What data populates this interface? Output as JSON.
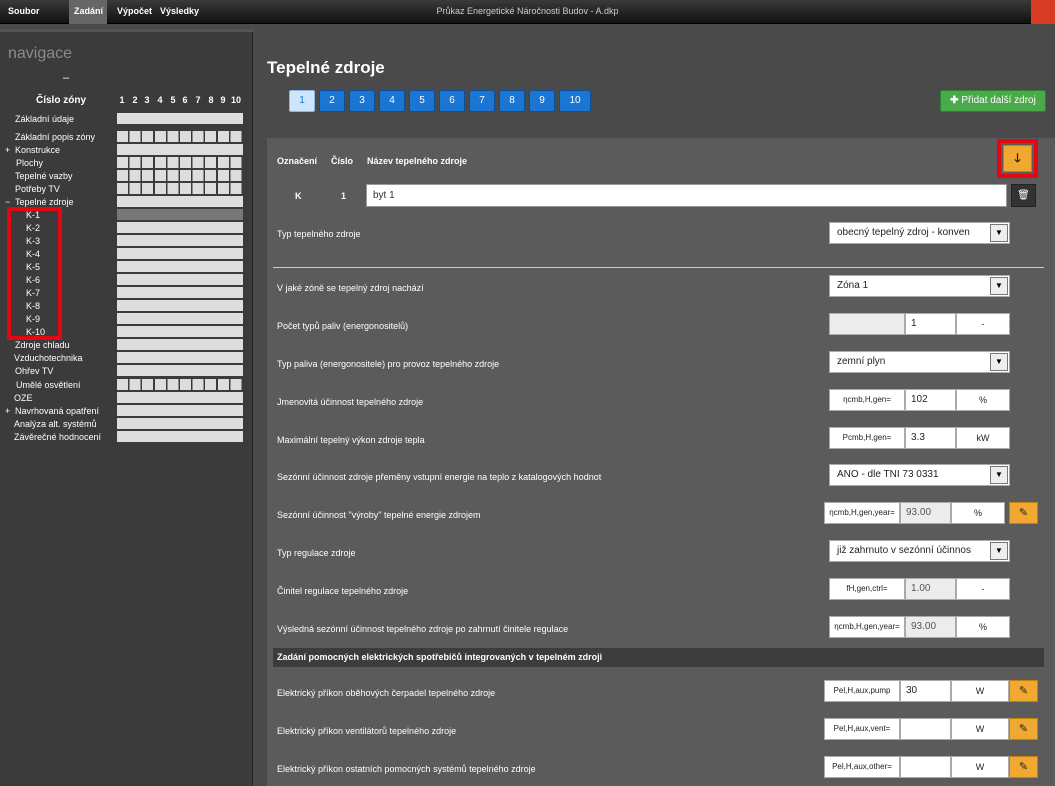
{
  "menu": {
    "soubor": "Soubor",
    "zadani": "Zadání",
    "vypocet": "Výpočet",
    "vysledky": "Výsledky"
  },
  "app_title": "Průkaz Energetické Náročnosti Budov - A.dkp",
  "sidebar": {
    "title": "navigace",
    "dash": "–",
    "zone_caption": "Číslo zóny",
    "zone_numbers": [
      "1",
      "2",
      "3",
      "4",
      "5",
      "6",
      "7",
      "8",
      "9",
      "10"
    ],
    "items": [
      {
        "label": "Základní údaje"
      },
      {
        "label": "Základní popis zóny"
      },
      {
        "label": "Konstrukce",
        "prefix": "+"
      },
      {
        "label": "Plochy"
      },
      {
        "label": "Tepelné vazby"
      },
      {
        "label": "Potřeby TV"
      },
      {
        "label": "Tepelné zdroje",
        "prefix": "−"
      },
      {
        "label": "K-1"
      },
      {
        "label": "K-2"
      },
      {
        "label": "K-3"
      },
      {
        "label": "K-4"
      },
      {
        "label": "K-5"
      },
      {
        "label": "K-6"
      },
      {
        "label": "K-7"
      },
      {
        "label": "K-8"
      },
      {
        "label": "K-9"
      },
      {
        "label": "K-10"
      },
      {
        "label": "Zdroje chladu"
      },
      {
        "label": "Vzduchotechnika"
      },
      {
        "label": "Ohřev TV"
      },
      {
        "label": "Umělé osvětlení"
      },
      {
        "label": "OZE"
      },
      {
        "label": "Navrhovaná opatření",
        "prefix": "+"
      },
      {
        "label": "Analýza alt. systémů"
      },
      {
        "label": "Závěrečné hodnocení"
      }
    ]
  },
  "main": {
    "title": "Tepelné zdroje",
    "tabs": [
      "1",
      "2",
      "3",
      "4",
      "5",
      "6",
      "7",
      "8",
      "9",
      "10"
    ],
    "add_button": "Přidat další zdroj",
    "headers": {
      "oznaceni": "Označení",
      "cislo": "Číslo",
      "nazev": "Název tepelného zdroje"
    },
    "source": {
      "oznaceni": "K",
      "cislo": "1",
      "nazev": "byt 1"
    },
    "typ_label": "Typ tepelného zdroje",
    "typ_value": "obecný tepelný zdroj - konven",
    "fields": [
      {
        "label": "V jaké zóně se tepelný zdroj nachází",
        "value": "Zóna 1"
      },
      {
        "label": "Počet typů paliv (energonositelů)",
        "value": "1",
        "unit": "-"
      },
      {
        "label": "Typ paliva (energonositele) pro provoz tepelného zdroje",
        "value": "zemní plyn"
      },
      {
        "label": "Jmenovitá účinnost tepelného zdroje",
        "sym": "ηcmb,H,gen=",
        "value": "102",
        "unit": "%"
      },
      {
        "label": "Maximální tepelný výkon zdroje tepla",
        "sym": "Pcmb,H,gen=",
        "value": "3.3",
        "unit": "kW"
      },
      {
        "label": "Sezónní účinnost zdroje přeměny vstupní energie na teplo z katalogových hodnot",
        "value": "ANO - dle TNI 73 0331"
      },
      {
        "label": "Sezónní účinnost \"výroby\" tepelné energie zdrojem",
        "sym": "ηcmb,H,gen,year=",
        "value": "93.00",
        "unit": "%"
      },
      {
        "label": "Typ regulace zdroje",
        "value": "již zahrnuto v sezónní účinnos"
      },
      {
        "label": "Činitel regulace tepelného zdroje",
        "sym": "fH,gen,ctrl=",
        "value": "1.00",
        "unit": "-"
      },
      {
        "label": "Výsledná sezónní účinnost tepelného zdroje po zahrnutí činitele regulace",
        "sym": "ηcmb,H,gen,year=",
        "value": "93.00",
        "unit": "%"
      }
    ],
    "section_title": "Zadání pomocných elektrických spotřebičů integrovaných v tepelném zdroji",
    "aux": [
      {
        "label": "Elektrický příkon oběhových čerpadel tepelného zdroje",
        "sym": "Pel,H,aux,pump",
        "value": "30",
        "unit": "W"
      },
      {
        "label": "Elektrický příkon ventilátorů tepelného zdroje",
        "sym": "Pel,H,aux,vent=",
        "value": "",
        "unit": "W"
      },
      {
        "label": "Elektrický příkon ostatních pomocných systémů tepelného zdroje",
        "sym": "Pel,H,aux,other=",
        "value": "",
        "unit": "W"
      }
    ]
  },
  "colors": {
    "accent_blue": "#1a76d2",
    "add_green": "#4aa94a",
    "orange": "#f0a830",
    "highlight_red": "#e30613"
  },
  "icons": {
    "arrow": "arrow-down-icon",
    "trash": "trash-icon",
    "edit": "pencil-icon",
    "plus": "plus-icon",
    "dropdown": "chevron-down-icon"
  }
}
